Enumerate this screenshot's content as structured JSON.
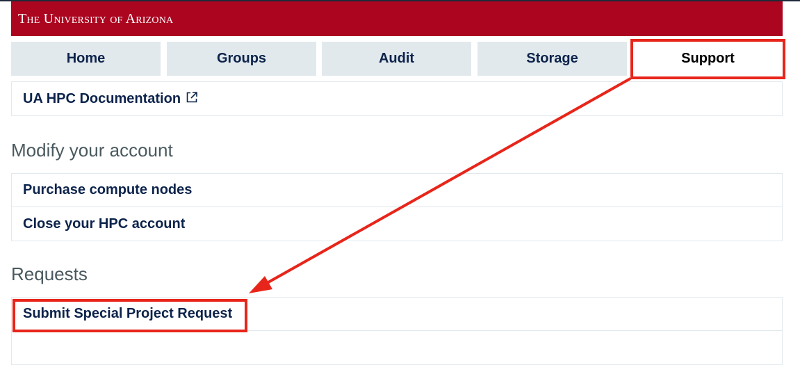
{
  "header": {
    "wordmark": "The University of Arizona",
    "brand_color": "#ab0520"
  },
  "nav": {
    "tabs": [
      {
        "label": "Home",
        "active": false
      },
      {
        "label": "Groups",
        "active": false
      },
      {
        "label": "Audit",
        "active": false
      },
      {
        "label": "Storage",
        "active": false
      },
      {
        "label": "Support",
        "active": true
      }
    ],
    "active_text_color": "#000000",
    "tab_text_color": "#0c234b",
    "tab_background": "#e2e9ed"
  },
  "documentation": {
    "link_label": "UA HPC Documentation",
    "icon": "external-link-icon"
  },
  "modify_section": {
    "heading": "Modify your account",
    "items": [
      {
        "label": "Purchase compute nodes"
      },
      {
        "label": "Close your HPC account"
      }
    ]
  },
  "requests_section": {
    "heading": "Requests",
    "items": [
      {
        "label": "Submit Special Project Request"
      },
      {
        "label": ""
      }
    ]
  },
  "annotations": {
    "color": "#e8251a",
    "highlights": [
      "Support",
      "Submit Special Project Request"
    ],
    "arrow": "from Support tab to Submit Special Project Request"
  }
}
